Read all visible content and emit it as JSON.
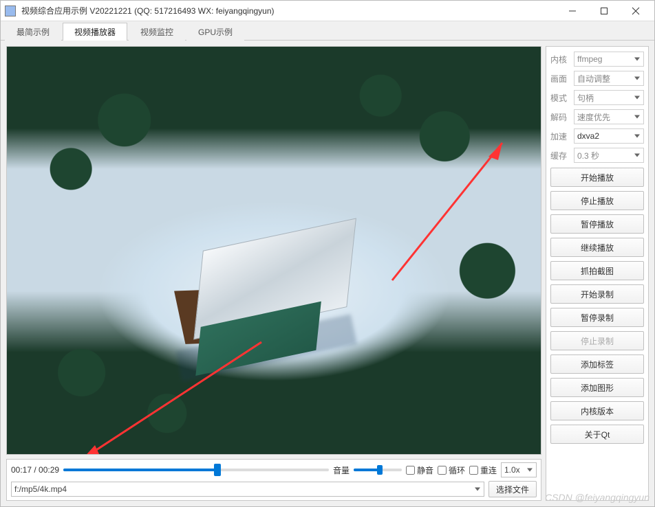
{
  "window": {
    "title": "视频综合应用示例 V20221221 (QQ: 517216493 WX: feiyangqingyun)"
  },
  "tabs": [
    {
      "label": "最简示例",
      "active": false
    },
    {
      "label": "视频播放器",
      "active": true
    },
    {
      "label": "视频监控",
      "active": false
    },
    {
      "label": "GPU示例",
      "active": false
    }
  ],
  "player": {
    "time_current": "00:17",
    "time_total": "00:29",
    "time_sep": " / ",
    "progress_pct": 58,
    "volume_label": "音量",
    "volume_pct": 55,
    "mute_label": "静音",
    "loop_label": "循环",
    "reconnect_label": "重连",
    "mute_checked": false,
    "loop_checked": false,
    "reconnect_checked": false,
    "speed_label": "1.0x",
    "file_path": "f:/mp5/4k.mp4",
    "choose_file_label": "选择文件"
  },
  "options": [
    {
      "label": "内核",
      "value": "ffmpeg"
    },
    {
      "label": "画面",
      "value": "自动调整"
    },
    {
      "label": "模式",
      "value": "句柄"
    },
    {
      "label": "解码",
      "value": "速度优先"
    },
    {
      "label": "加速",
      "value": "dxva2"
    },
    {
      "label": "缓存",
      "value": "0.3 秒"
    }
  ],
  "buttons": [
    {
      "label": "开始播放",
      "disabled": false
    },
    {
      "label": "停止播放",
      "disabled": false
    },
    {
      "label": "暂停播放",
      "disabled": false
    },
    {
      "label": "继续播放",
      "disabled": false
    },
    {
      "label": "抓拍截图",
      "disabled": false
    },
    {
      "label": "开始录制",
      "disabled": false
    },
    {
      "label": "暂停录制",
      "disabled": false
    },
    {
      "label": "停止录制",
      "disabled": true
    },
    {
      "label": "添加标签",
      "disabled": false
    },
    {
      "label": "添加图形",
      "disabled": false
    },
    {
      "label": "内核版本",
      "disabled": false
    },
    {
      "label": "关于Qt",
      "disabled": false
    }
  ],
  "watermark": "CSDN @feiyangqingyun"
}
